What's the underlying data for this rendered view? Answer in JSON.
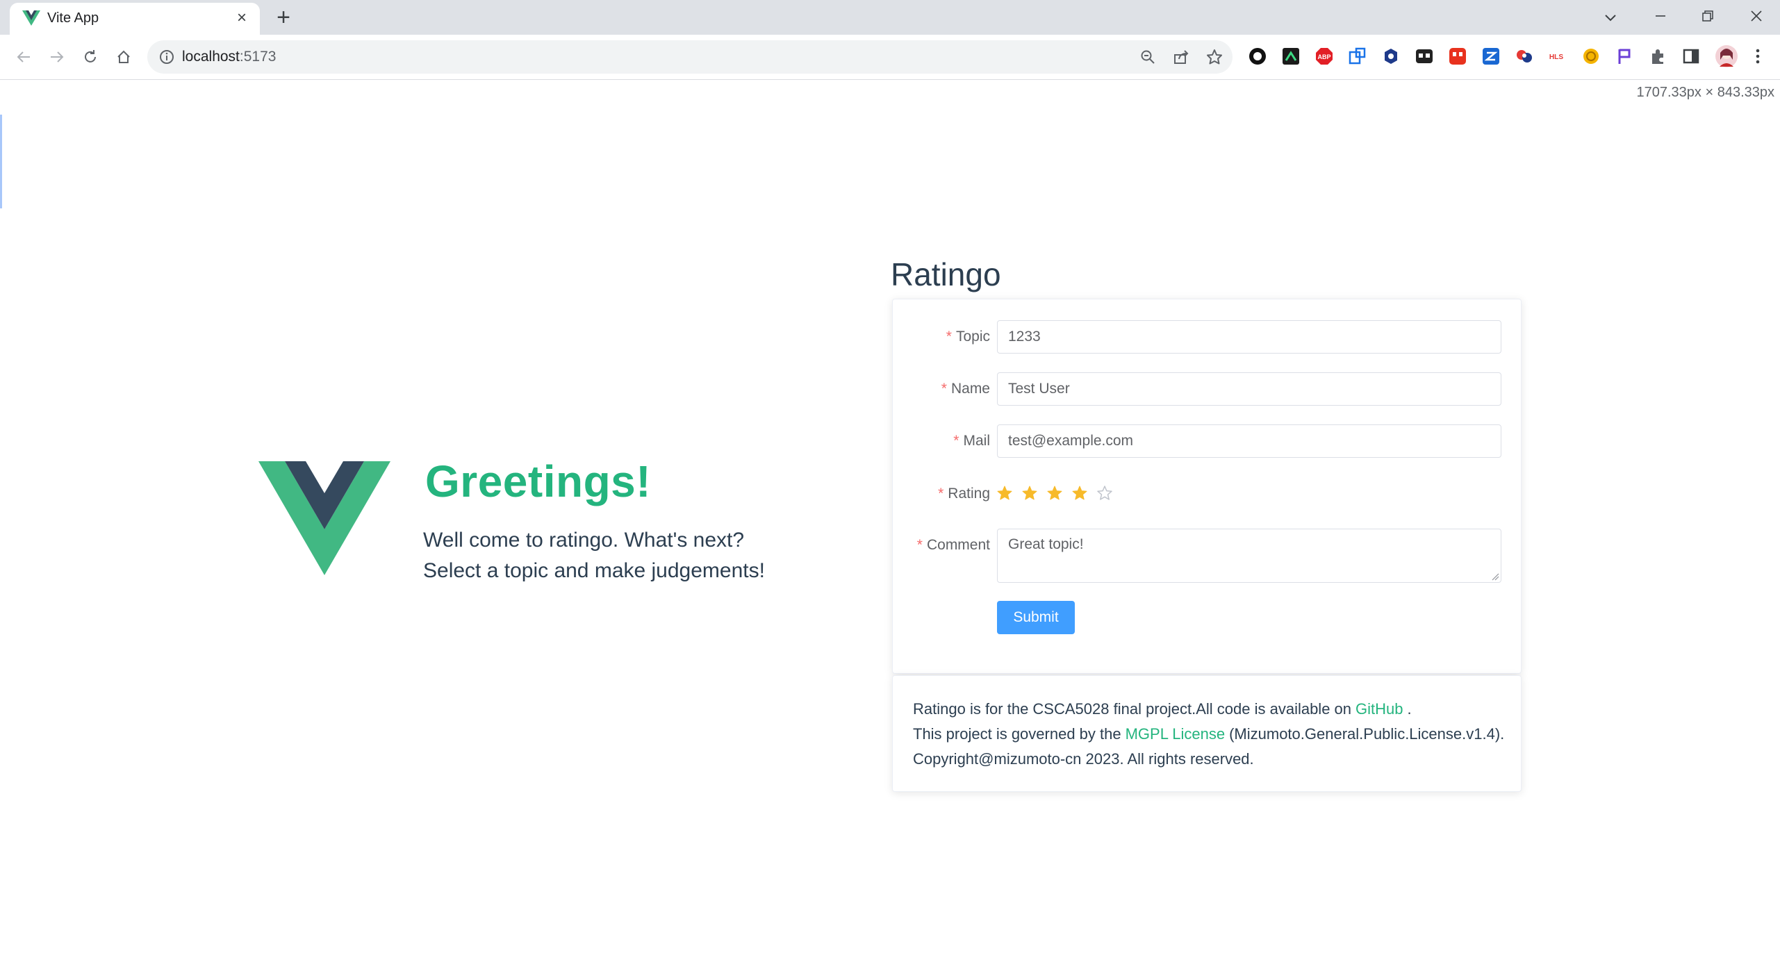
{
  "browser": {
    "tab_title": "Vite App",
    "url_host": "localhost",
    "url_port": ":5173",
    "dimension_readout": "1707.33px × 843.33px"
  },
  "hero": {
    "title": "Greetings!",
    "line1": "Well come to ratingo. What's next?",
    "line2": "Select a topic and make judgements!"
  },
  "form": {
    "app_title": "Ratingo",
    "required_mark": "*",
    "topic_label": "Topic",
    "topic_value": "1233",
    "name_label": "Name",
    "name_value": "Test User",
    "mail_label": "Mail",
    "mail_value": "test@example.com",
    "rating_label": "Rating",
    "rating_value": 4,
    "rating_max": 5,
    "comment_label": "Comment",
    "comment_value": "Great topic!",
    "submit_label": "Submit"
  },
  "footer": {
    "line1_text": "Ratingo is for the CSCA5028 final project.All code is available on",
    "line1_link": "GitHub",
    "line1_end": ".",
    "line2_text": "This project is governed by the",
    "line2_link": "MGPL License",
    "line2_end": "(Mizumoto.General.Public.License.v1.4).",
    "line3_text": "Copyright@mizumoto-cn 2023. All rights reserved."
  },
  "colors": {
    "accent_green": "#24b47e",
    "vue_dark": "#35495e",
    "vue_green": "#41b883",
    "primary_button": "#409eff",
    "star_filled": "#f7ba2a",
    "required": "#f56c6c"
  }
}
